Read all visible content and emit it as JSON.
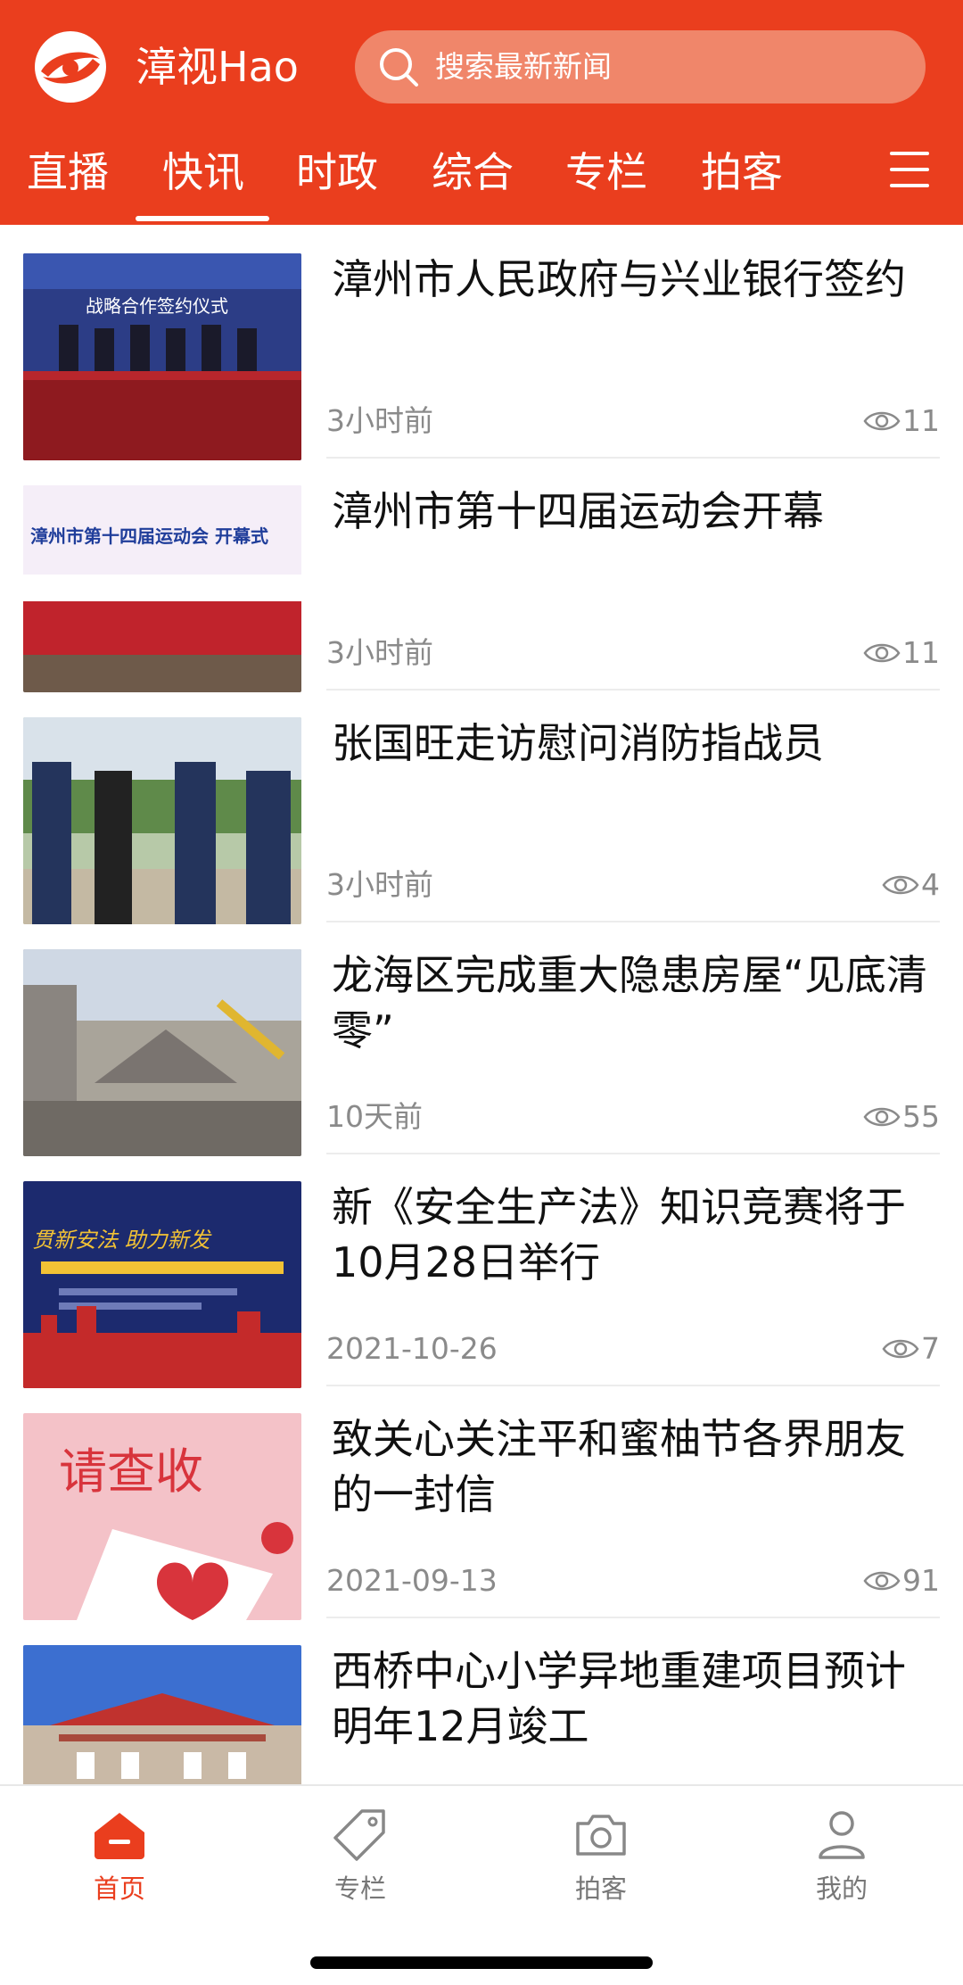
{
  "header": {
    "brand": "漳视Hao",
    "search_placeholder": "搜索最新新闻",
    "accent_color": "#ea3e1e"
  },
  "tabs": [
    {
      "label": "直播",
      "active": false
    },
    {
      "label": "快讯",
      "active": true
    },
    {
      "label": "时政",
      "active": false
    },
    {
      "label": "综合",
      "active": false
    },
    {
      "label": "专栏",
      "active": false
    },
    {
      "label": "拍客",
      "active": false
    }
  ],
  "news": [
    {
      "title": "漳州市人民政府与兴业银行签约",
      "time": "3小时前",
      "views": "11",
      "thumb_text": "战略合作签约仪式"
    },
    {
      "title": "漳州市第十四届运动会开幕",
      "time": "3小时前",
      "views": "11",
      "thumb_text": "漳州市第十四届运动会 开幕式"
    },
    {
      "title": "张国旺走访慰问消防指战员",
      "time": "3小时前",
      "views": "4"
    },
    {
      "title": "龙海区完成重大隐患房屋“见底清零”",
      "time": "10天前",
      "views": "55"
    },
    {
      "title": "新《安全生产法》知识竞赛将于10月28日举行",
      "time": "2021-10-26",
      "views": "7",
      "thumb_text": "贯新安法 助力新发"
    },
    {
      "title": "致关心关注平和蜜柚节各界朋友的一封信",
      "time": "2021-09-13",
      "views": "91",
      "thumb_text": "请查收"
    },
    {
      "title": "西桥中心小学异地重建项目预计明年12月竣工"
    }
  ],
  "bottom_nav": [
    {
      "label": "首页",
      "icon": "home-icon",
      "active": true
    },
    {
      "label": "专栏",
      "icon": "tag-icon",
      "active": false
    },
    {
      "label": "拍客",
      "icon": "camera-icon",
      "active": false
    },
    {
      "label": "我的",
      "icon": "user-icon",
      "active": false
    }
  ]
}
